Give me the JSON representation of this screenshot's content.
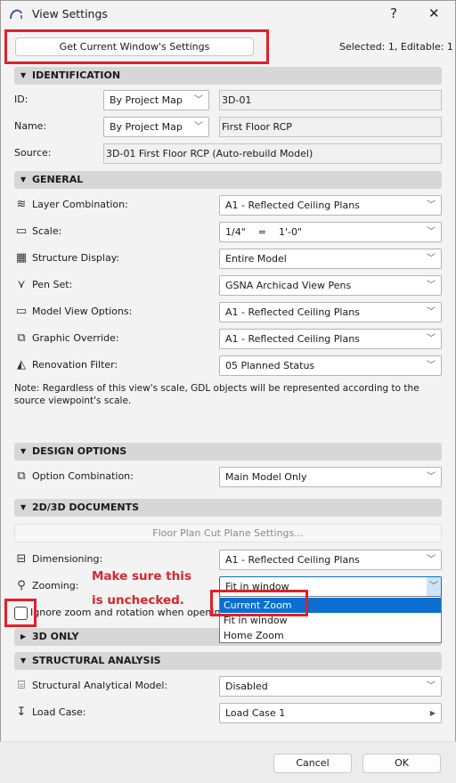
{
  "window": {
    "title": "View Settings",
    "help": "?",
    "close": "✕",
    "app_icon": "archicad-logo-icon"
  },
  "top": {
    "get_settings_label": "Get Current Window's Settings",
    "selection_status": "Selected: 1, Editable: 1"
  },
  "identification": {
    "header": "IDENTIFICATION",
    "id_label": "ID:",
    "id_mode": "By Project Map",
    "id_value": "3D-01",
    "name_label": "Name:",
    "name_mode": "By Project Map",
    "name_value": "First Floor RCP",
    "source_label": "Source:",
    "source_value": "3D-01 First Floor RCP (Auto-rebuild Model)"
  },
  "general": {
    "header": "GENERAL",
    "rows": [
      {
        "label": "Layer Combination:",
        "value": "A1 - Reflected Ceiling Plans",
        "icon": "layers-icon"
      },
      {
        "label": "Scale:",
        "value": "1/4\"    =    1'-0\"",
        "icon": "scale-icon"
      },
      {
        "label": "Structure Display:",
        "value": "Entire Model",
        "icon": "structure-display-icon"
      },
      {
        "label": "Pen Set:",
        "value": "GSNA Archicad View Pens",
        "icon": "pen-icon"
      },
      {
        "label": "Model View Options:",
        "value": "A1 - Reflected Ceiling Plans",
        "icon": "model-view-icon"
      },
      {
        "label": "Graphic Override:",
        "value": "A1 - Reflected Ceiling Plans",
        "icon": "graphic-override-icon"
      },
      {
        "label": "Renovation Filter:",
        "value": "05 Planned Status",
        "icon": "renovation-icon"
      }
    ],
    "note": "Note: Regardless of this view's scale, GDL objects will be represented according to the source viewpoint's scale."
  },
  "design_options": {
    "header": "DESIGN OPTIONS",
    "label": "Option Combination:",
    "value": "Main Model Only"
  },
  "documents": {
    "header": "2D/3D DOCUMENTS",
    "cut_plane_button": "Floor Plan Cut Plane Settings...",
    "dimensioning_label": "Dimensioning:",
    "dimensioning_value": "A1 - Reflected Ceiling Plans",
    "zooming_label": "Zooming:",
    "zooming_value": "Fit in window",
    "zoom_options": [
      "Current Zoom",
      "Fit in window",
      "Home Zoom"
    ],
    "highlighted_option": "Current Zoom",
    "ignore_zoom_label": "Ignore zoom and rotation when opening",
    "ignore_zoom_checked": false
  },
  "three_d_only": {
    "header": "3D ONLY"
  },
  "structural": {
    "header": "STRUCTURAL ANALYSIS",
    "model_label": "Structural Analytical Model:",
    "model_value": "Disabled",
    "load_case_label": "Load Case:",
    "load_case_value": "Load Case 1"
  },
  "annotation": {
    "line1": "Make sure this",
    "line2": "is unchecked."
  },
  "footer": {
    "cancel": "Cancel",
    "ok": "OK"
  },
  "colors": {
    "annotation_red": "#e0202a",
    "selection_blue": "#0a6fd1"
  }
}
